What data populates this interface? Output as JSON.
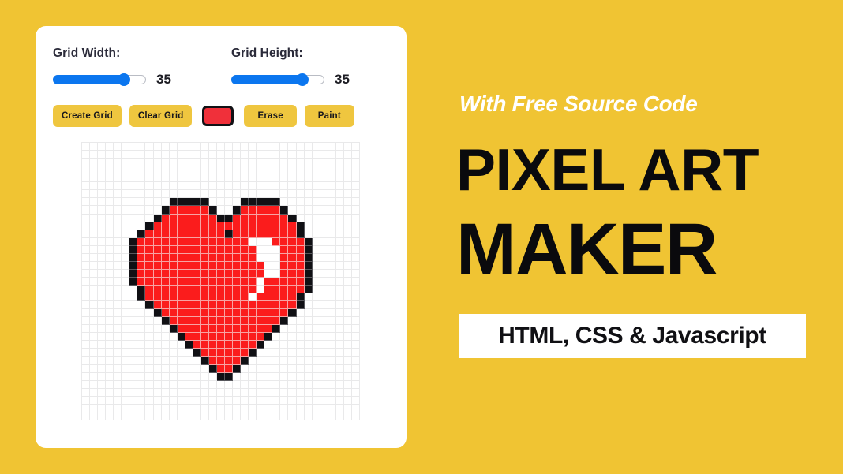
{
  "theme": {
    "background": "#f0c433",
    "card_background": "#ffffff",
    "button_background": "#efc63f",
    "slider_accent": "#0b76ef",
    "paint_color": "#f0303a",
    "pixel_red": "#fb1c1c",
    "pixel_black": "#101014"
  },
  "app": {
    "grid_width": {
      "label": "Grid Width:",
      "value": "35",
      "percent": 80
    },
    "grid_height": {
      "label": "Grid Height:",
      "value": "35",
      "percent": 80
    },
    "buttons": {
      "create_grid": "Create Grid",
      "clear_grid": "Clear Grid",
      "erase": "Erase",
      "paint": "Paint"
    },
    "color_picker": {
      "name": "color-picker",
      "value": "#f0303a"
    },
    "canvas": {
      "columns": 35,
      "rows": 35,
      "red_cells": [
        [
          8,
          11
        ],
        [
          8,
          12
        ],
        [
          8,
          13
        ],
        [
          8,
          14
        ],
        [
          8,
          15
        ],
        [
          8,
          20
        ],
        [
          8,
          21
        ],
        [
          8,
          22
        ],
        [
          8,
          23
        ],
        [
          8,
          24
        ],
        [
          9,
          10
        ],
        [
          9,
          11
        ],
        [
          9,
          12
        ],
        [
          9,
          13
        ],
        [
          9,
          14
        ],
        [
          9,
          15
        ],
        [
          9,
          16
        ],
        [
          9,
          19
        ],
        [
          9,
          20
        ],
        [
          9,
          21
        ],
        [
          9,
          22
        ],
        [
          9,
          23
        ],
        [
          9,
          24
        ],
        [
          9,
          25
        ],
        [
          10,
          9
        ],
        [
          10,
          10
        ],
        [
          10,
          11
        ],
        [
          10,
          12
        ],
        [
          10,
          13
        ],
        [
          10,
          14
        ],
        [
          10,
          15
        ],
        [
          10,
          16
        ],
        [
          10,
          17
        ],
        [
          10,
          18
        ],
        [
          10,
          19
        ],
        [
          10,
          20
        ],
        [
          10,
          21
        ],
        [
          10,
          22
        ],
        [
          10,
          23
        ],
        [
          10,
          24
        ],
        [
          10,
          25
        ],
        [
          10,
          26
        ],
        [
          11,
          8
        ],
        [
          11,
          9
        ],
        [
          11,
          10
        ],
        [
          11,
          11
        ],
        [
          11,
          12
        ],
        [
          11,
          13
        ],
        [
          11,
          14
        ],
        [
          11,
          15
        ],
        [
          11,
          16
        ],
        [
          11,
          17
        ],
        [
          11,
          19
        ],
        [
          11,
          20
        ],
        [
          11,
          21
        ],
        [
          11,
          22
        ],
        [
          11,
          23
        ],
        [
          11,
          24
        ],
        [
          11,
          25
        ],
        [
          11,
          26
        ],
        [
          12,
          7
        ],
        [
          12,
          8
        ],
        [
          12,
          9
        ],
        [
          12,
          10
        ],
        [
          12,
          11
        ],
        [
          12,
          12
        ],
        [
          12,
          13
        ],
        [
          12,
          14
        ],
        [
          12,
          15
        ],
        [
          12,
          16
        ],
        [
          12,
          17
        ],
        [
          12,
          18
        ],
        [
          12,
          19
        ],
        [
          12,
          20
        ],
        [
          12,
          24
        ],
        [
          12,
          25
        ],
        [
          12,
          26
        ],
        [
          12,
          27
        ],
        [
          13,
          7
        ],
        [
          13,
          8
        ],
        [
          13,
          9
        ],
        [
          13,
          10
        ],
        [
          13,
          11
        ],
        [
          13,
          12
        ],
        [
          13,
          13
        ],
        [
          13,
          14
        ],
        [
          13,
          15
        ],
        [
          13,
          16
        ],
        [
          13,
          17
        ],
        [
          13,
          18
        ],
        [
          13,
          19
        ],
        [
          13,
          20
        ],
        [
          13,
          21
        ],
        [
          13,
          25
        ],
        [
          13,
          26
        ],
        [
          13,
          27
        ],
        [
          14,
          7
        ],
        [
          14,
          8
        ],
        [
          14,
          9
        ],
        [
          14,
          10
        ],
        [
          14,
          11
        ],
        [
          14,
          12
        ],
        [
          14,
          13
        ],
        [
          14,
          14
        ],
        [
          14,
          15
        ],
        [
          14,
          16
        ],
        [
          14,
          17
        ],
        [
          14,
          18
        ],
        [
          14,
          19
        ],
        [
          14,
          20
        ],
        [
          14,
          21
        ],
        [
          14,
          25
        ],
        [
          14,
          26
        ],
        [
          14,
          27
        ],
        [
          15,
          7
        ],
        [
          15,
          8
        ],
        [
          15,
          9
        ],
        [
          15,
          10
        ],
        [
          15,
          11
        ],
        [
          15,
          12
        ],
        [
          15,
          13
        ],
        [
          15,
          14
        ],
        [
          15,
          15
        ],
        [
          15,
          16
        ],
        [
          15,
          17
        ],
        [
          15,
          18
        ],
        [
          15,
          19
        ],
        [
          15,
          20
        ],
        [
          15,
          21
        ],
        [
          15,
          22
        ],
        [
          15,
          25
        ],
        [
          15,
          26
        ],
        [
          15,
          27
        ],
        [
          16,
          7
        ],
        [
          16,
          8
        ],
        [
          16,
          9
        ],
        [
          16,
          10
        ],
        [
          16,
          11
        ],
        [
          16,
          12
        ],
        [
          16,
          13
        ],
        [
          16,
          14
        ],
        [
          16,
          15
        ],
        [
          16,
          16
        ],
        [
          16,
          17
        ],
        [
          16,
          18
        ],
        [
          16,
          19
        ],
        [
          16,
          20
        ],
        [
          16,
          21
        ],
        [
          16,
          22
        ],
        [
          16,
          25
        ],
        [
          16,
          26
        ],
        [
          16,
          27
        ],
        [
          17,
          7
        ],
        [
          17,
          8
        ],
        [
          17,
          9
        ],
        [
          17,
          10
        ],
        [
          17,
          11
        ],
        [
          17,
          12
        ],
        [
          17,
          13
        ],
        [
          17,
          14
        ],
        [
          17,
          15
        ],
        [
          17,
          16
        ],
        [
          17,
          17
        ],
        [
          17,
          18
        ],
        [
          17,
          19
        ],
        [
          17,
          20
        ],
        [
          17,
          21
        ],
        [
          17,
          23
        ],
        [
          17,
          24
        ],
        [
          17,
          25
        ],
        [
          17,
          26
        ],
        [
          17,
          27
        ],
        [
          18,
          8
        ],
        [
          18,
          9
        ],
        [
          18,
          10
        ],
        [
          18,
          11
        ],
        [
          18,
          12
        ],
        [
          18,
          13
        ],
        [
          18,
          14
        ],
        [
          18,
          15
        ],
        [
          18,
          16
        ],
        [
          18,
          17
        ],
        [
          18,
          18
        ],
        [
          18,
          19
        ],
        [
          18,
          20
        ],
        [
          18,
          21
        ],
        [
          18,
          23
        ],
        [
          18,
          24
        ],
        [
          18,
          25
        ],
        [
          18,
          26
        ],
        [
          18,
          27
        ],
        [
          19,
          8
        ],
        [
          19,
          9
        ],
        [
          19,
          10
        ],
        [
          19,
          11
        ],
        [
          19,
          12
        ],
        [
          19,
          13
        ],
        [
          19,
          14
        ],
        [
          19,
          15
        ],
        [
          19,
          16
        ],
        [
          19,
          17
        ],
        [
          19,
          18
        ],
        [
          19,
          19
        ],
        [
          19,
          20
        ],
        [
          19,
          22
        ],
        [
          19,
          23
        ],
        [
          19,
          24
        ],
        [
          19,
          25
        ],
        [
          19,
          26
        ],
        [
          20,
          9
        ],
        [
          20,
          10
        ],
        [
          20,
          11
        ],
        [
          20,
          12
        ],
        [
          20,
          13
        ],
        [
          20,
          14
        ],
        [
          20,
          15
        ],
        [
          20,
          16
        ],
        [
          20,
          17
        ],
        [
          20,
          18
        ],
        [
          20,
          19
        ],
        [
          20,
          20
        ],
        [
          20,
          21
        ],
        [
          20,
          22
        ],
        [
          20,
          23
        ],
        [
          20,
          24
        ],
        [
          20,
          25
        ],
        [
          20,
          26
        ],
        [
          21,
          10
        ],
        [
          21,
          11
        ],
        [
          21,
          12
        ],
        [
          21,
          13
        ],
        [
          21,
          14
        ],
        [
          21,
          15
        ],
        [
          21,
          16
        ],
        [
          21,
          17
        ],
        [
          21,
          18
        ],
        [
          21,
          19
        ],
        [
          21,
          20
        ],
        [
          21,
          21
        ],
        [
          21,
          22
        ],
        [
          21,
          23
        ],
        [
          21,
          24
        ],
        [
          21,
          25
        ],
        [
          22,
          11
        ],
        [
          22,
          12
        ],
        [
          22,
          13
        ],
        [
          22,
          14
        ],
        [
          22,
          15
        ],
        [
          22,
          16
        ],
        [
          22,
          17
        ],
        [
          22,
          18
        ],
        [
          22,
          19
        ],
        [
          22,
          20
        ],
        [
          22,
          21
        ],
        [
          22,
          22
        ],
        [
          22,
          23
        ],
        [
          22,
          24
        ],
        [
          23,
          12
        ],
        [
          23,
          13
        ],
        [
          23,
          14
        ],
        [
          23,
          15
        ],
        [
          23,
          16
        ],
        [
          23,
          17
        ],
        [
          23,
          18
        ],
        [
          23,
          19
        ],
        [
          23,
          20
        ],
        [
          23,
          21
        ],
        [
          23,
          22
        ],
        [
          23,
          23
        ],
        [
          24,
          13
        ],
        [
          24,
          14
        ],
        [
          24,
          15
        ],
        [
          24,
          16
        ],
        [
          24,
          17
        ],
        [
          24,
          18
        ],
        [
          24,
          19
        ],
        [
          24,
          20
        ],
        [
          24,
          21
        ],
        [
          24,
          22
        ],
        [
          25,
          14
        ],
        [
          25,
          15
        ],
        [
          25,
          16
        ],
        [
          25,
          17
        ],
        [
          25,
          18
        ],
        [
          25,
          19
        ],
        [
          25,
          20
        ],
        [
          25,
          21
        ],
        [
          26,
          15
        ],
        [
          26,
          16
        ],
        [
          26,
          17
        ],
        [
          26,
          18
        ],
        [
          26,
          19
        ],
        [
          26,
          20
        ],
        [
          27,
          16
        ],
        [
          27,
          17
        ],
        [
          27,
          18
        ],
        [
          27,
          19
        ],
        [
          28,
          17
        ],
        [
          28,
          18
        ]
      ],
      "black_cells": [
        [
          7,
          11
        ],
        [
          7,
          12
        ],
        [
          7,
          13
        ],
        [
          7,
          14
        ],
        [
          7,
          15
        ],
        [
          7,
          20
        ],
        [
          7,
          21
        ],
        [
          7,
          22
        ],
        [
          7,
          23
        ],
        [
          7,
          24
        ],
        [
          8,
          10
        ],
        [
          8,
          16
        ],
        [
          8,
          19
        ],
        [
          8,
          25
        ],
        [
          9,
          9
        ],
        [
          9,
          17
        ],
        [
          9,
          18
        ],
        [
          9,
          26
        ],
        [
          10,
          8
        ],
        [
          10,
          27
        ],
        [
          11,
          7
        ],
        [
          11,
          18
        ],
        [
          11,
          27
        ],
        [
          12,
          6
        ],
        [
          12,
          28
        ],
        [
          13,
          6
        ],
        [
          13,
          28
        ],
        [
          14,
          6
        ],
        [
          14,
          28
        ],
        [
          15,
          6
        ],
        [
          15,
          28
        ],
        [
          16,
          6
        ],
        [
          16,
          28
        ],
        [
          17,
          6
        ],
        [
          17,
          28
        ],
        [
          18,
          7
        ],
        [
          18,
          28
        ],
        [
          19,
          7
        ],
        [
          19,
          27
        ],
        [
          20,
          8
        ],
        [
          20,
          27
        ],
        [
          21,
          9
        ],
        [
          21,
          26
        ],
        [
          22,
          10
        ],
        [
          22,
          25
        ],
        [
          23,
          11
        ],
        [
          23,
          24
        ],
        [
          24,
          12
        ],
        [
          24,
          23
        ],
        [
          25,
          13
        ],
        [
          25,
          22
        ],
        [
          26,
          14
        ],
        [
          26,
          21
        ],
        [
          27,
          15
        ],
        [
          27,
          20
        ],
        [
          28,
          16
        ],
        [
          28,
          19
        ],
        [
          29,
          17
        ],
        [
          29,
          18
        ]
      ]
    }
  },
  "promo": {
    "kicker": "With Free Source Code",
    "title_line_1": "PIXEL ART",
    "title_line_2": "MAKER",
    "badge": "HTML, CSS & Javascript"
  }
}
